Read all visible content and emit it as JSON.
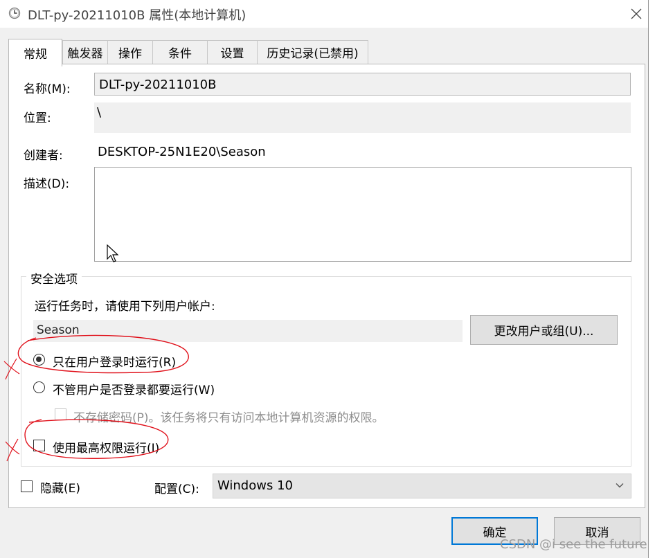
{
  "window": {
    "title": "DLT-py-20211010B 属性(本地计算机)",
    "close_glyph": "✕"
  },
  "tabs": [
    {
      "label": "常规",
      "active": true
    },
    {
      "label": "触发器"
    },
    {
      "label": "操作"
    },
    {
      "label": "条件"
    },
    {
      "label": "设置"
    },
    {
      "label": "历史记录(已禁用)"
    }
  ],
  "general": {
    "name_label": "名称(M):",
    "name_value": "DLT-py-20211010B",
    "location_label": "位置:",
    "location_value": "\\",
    "author_label": "创建者:",
    "author_value": "DESKTOP-25N1E20\\Season",
    "description_label": "描述(D):",
    "description_value": ""
  },
  "security": {
    "group_title": "安全选项",
    "run_as_prompt": "运行任务时，请使用下列用户帐户:",
    "user_account": "Season",
    "change_user_button": "更改用户或组(U)...",
    "radio_logged_on": {
      "label": "只在用户登录时运行(R)",
      "checked": true
    },
    "radio_whether_logged": {
      "label": "不管用户是否登录都要运行(W)",
      "checked": false
    },
    "checkbox_no_password": {
      "label": "不存储密码(P)。该任务将只有访问本地计算机资源的权限。",
      "checked": false,
      "enabled": false
    },
    "checkbox_highest_privileges": {
      "label": "使用最高权限运行(I)",
      "checked": false
    }
  },
  "bottom": {
    "hidden_label": "隐藏(E)",
    "hidden_checked": false,
    "config_label": "配置(C):",
    "config_value": "Windows 10"
  },
  "buttons": {
    "ok": "确定",
    "cancel": "取消"
  },
  "watermark": "CSDN @i see the future",
  "colors": {
    "annotation_red": "#e0101a",
    "accent_blue": "#0078d7",
    "client_bg": "#f0f0f0"
  }
}
